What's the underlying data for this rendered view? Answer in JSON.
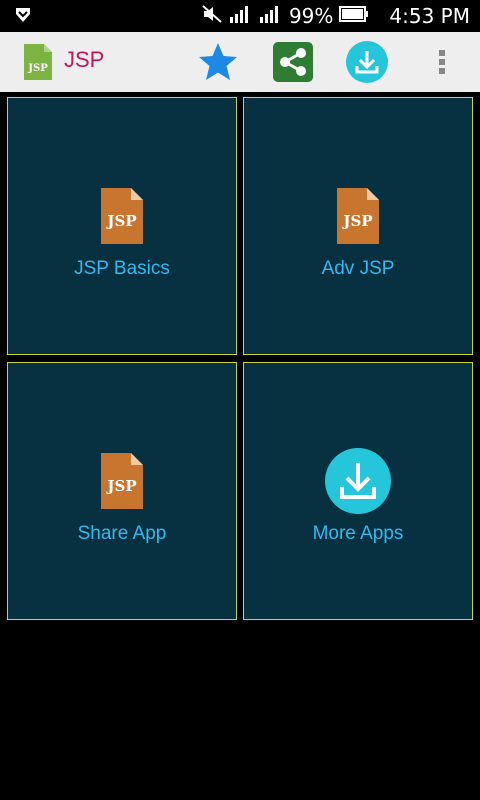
{
  "status_bar": {
    "battery": "99%",
    "time": "4:53 PM"
  },
  "app_bar": {
    "title": "JSP",
    "app_icon_text": "JSP"
  },
  "tiles": [
    {
      "label": "JSP Basics",
      "icon": "jsp-file-icon",
      "icon_text": "JSP"
    },
    {
      "label": "Adv JSP",
      "icon": "jsp-file-icon",
      "icon_text": "JSP"
    },
    {
      "label": "Share App",
      "icon": "jsp-file-icon",
      "icon_text": "JSP"
    },
    {
      "label": "More Apps",
      "icon": "download-circle-icon"
    }
  ],
  "colors": {
    "tile_bg": "#073040",
    "tile_border": "#c9d63a",
    "label": "#35b8f0",
    "title": "#c2185b",
    "file_icon": "#c8762f"
  }
}
